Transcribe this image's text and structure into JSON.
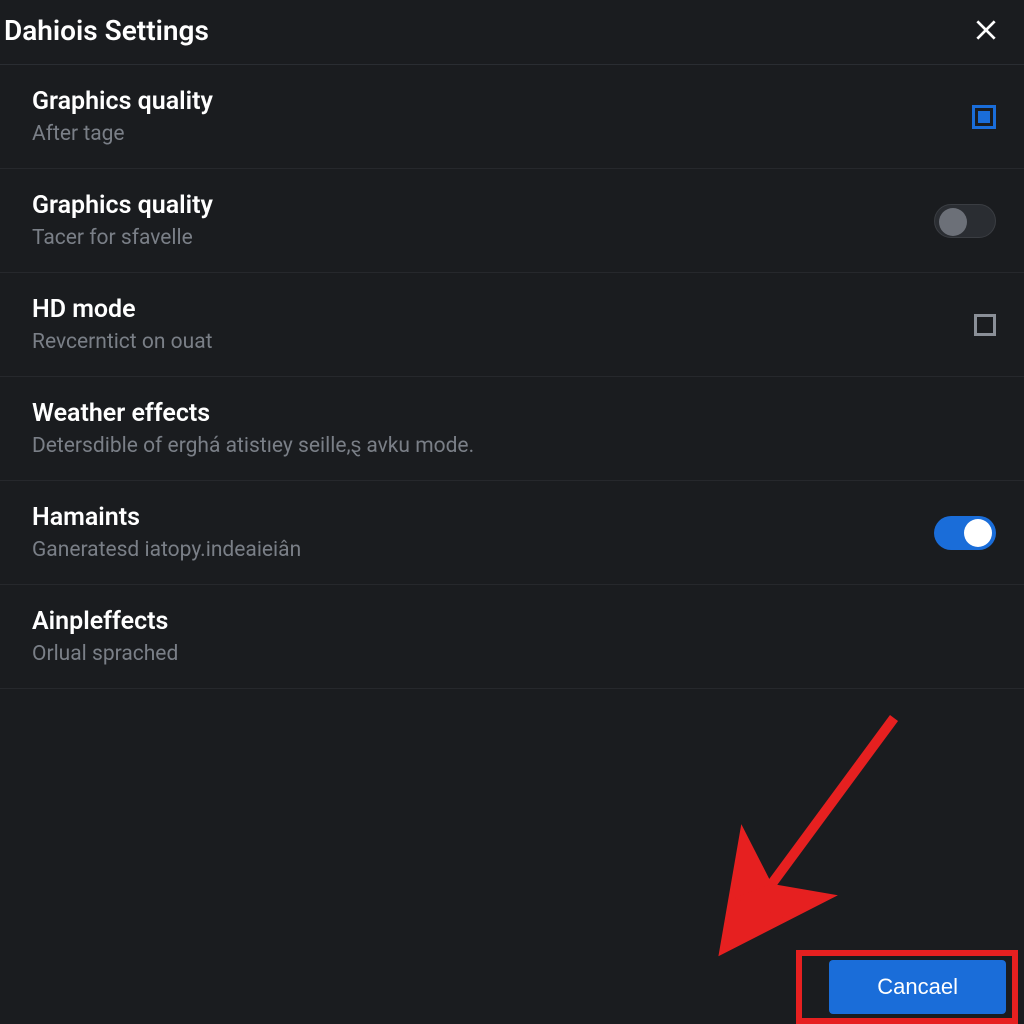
{
  "header": {
    "title": "Dahiois Settings"
  },
  "settings": [
    {
      "title": "Graphics quality",
      "subtitle": "After tage",
      "control": "checkbox-filled"
    },
    {
      "title": "Graphics quality",
      "subtitle": "Tacer for sfavelle",
      "control": "toggle-off"
    },
    {
      "title": "HD mode",
      "subtitle": "Revcerntict on ouat",
      "control": "checkbox-empty"
    },
    {
      "title": "Weather effects",
      "subtitle": "Detersdible of erghá atistıey seille,ȿ avku mode.",
      "control": "none"
    },
    {
      "title": "Hamaints",
      "subtitle": "Ganeratesd iatopy.indeaieiân",
      "control": "toggle-on"
    },
    {
      "title": "Ainpleffects",
      "subtitle": "Orlual sprached",
      "control": "none"
    }
  ],
  "footer": {
    "cancel_label": "Cancael"
  }
}
